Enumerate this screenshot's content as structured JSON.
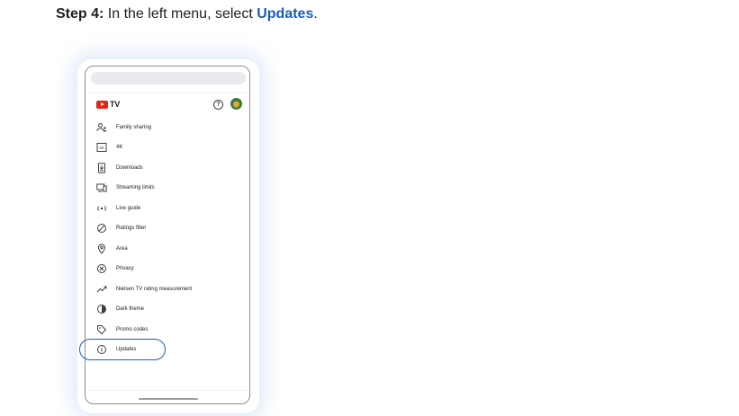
{
  "instruction": {
    "step_prefix": "Step 4:",
    "text_before": " In the left menu, select ",
    "target": "Updates",
    "text_after": "."
  },
  "app": {
    "logo_text": "TV",
    "help_icon": "help-circle-icon",
    "avatar_icon": "account-avatar"
  },
  "menu": {
    "items": [
      {
        "label": "Family sharing",
        "icon": "family-icon"
      },
      {
        "label": "4K",
        "icon": "4k-icon"
      },
      {
        "label": "Downloads",
        "icon": "download-icon"
      },
      {
        "label": "Streaming limits",
        "icon": "devices-icon"
      },
      {
        "label": "Live guide",
        "icon": "live-icon"
      },
      {
        "label": "Ratings filter",
        "icon": "block-icon"
      },
      {
        "label": "Area",
        "icon": "location-icon"
      },
      {
        "label": "Privacy",
        "icon": "privacy-icon"
      },
      {
        "label": "Nielsen TV rating measurement",
        "icon": "trending-icon"
      },
      {
        "label": "Dark theme",
        "icon": "theme-icon"
      },
      {
        "label": "Promo codes",
        "icon": "tag-icon"
      },
      {
        "label": "Updates",
        "icon": "info-icon"
      }
    ]
  },
  "colors": {
    "accent": "#1a5fb4",
    "youtube_red": "#e62117"
  }
}
